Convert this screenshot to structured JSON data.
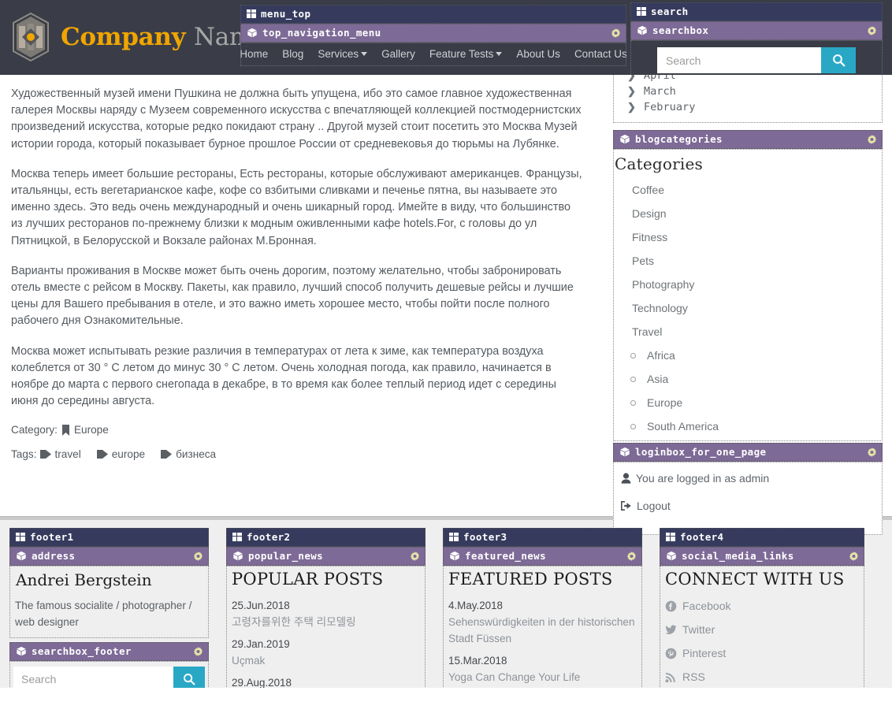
{
  "brand": {
    "name_bold": "Company",
    "name_light": "Name",
    "logo_icon": "hexagon-logo-icon"
  },
  "blocks": {
    "menu_top": "menu_top",
    "search": "search",
    "footer1": "footer1",
    "footer2": "footer2",
    "footer3": "footer3",
    "footer4": "footer4"
  },
  "widgets": {
    "top_navigation_menu": "top_navigation_menu",
    "searchbox": "searchbox",
    "blogcategories": "blogcategories",
    "loginbox_for_one_page": "loginbox_for_one_page",
    "address": "address",
    "searchbox_footer": "searchbox_footer",
    "popular_news": "popular_news",
    "featured_news": "featured_news",
    "social_media_links": "social_media_links"
  },
  "nav": {
    "items": [
      {
        "label": "Home",
        "dropdown": false
      },
      {
        "label": "Blog",
        "dropdown": false
      },
      {
        "label": "Services",
        "dropdown": true
      },
      {
        "label": "Gallery",
        "dropdown": false
      },
      {
        "label": "Feature Tests",
        "dropdown": true
      },
      {
        "label": "About Us",
        "dropdown": false
      },
      {
        "label": "Contact Us",
        "dropdown": false
      }
    ]
  },
  "search": {
    "placeholder": "Search",
    "value": "",
    "icon": "search-icon"
  },
  "article": {
    "paragraphs": [
      "Художественный музей имени Пушкина не должна быть упущена, ибо это самое главное художественная галерея Москвы наряду с Музеем современного искусства с впечатляющей коллекцией постмодернистских произведений искусства, которые редко покидают страну .. Другой музей стоит посетить это Москва Музей истории города, который показывает бурное прошлое России от средневековья до тюрьмы на Лубянке.",
      "Москва теперь имеет большие рестораны, Есть рестораны, которые обслуживают американцев. Французы, итальянцы, есть вегетарианское кафе, кофе со взбитыми сливками и печенье пятна, вы называете это именно здесь. Это ведь очень международный и очень шикарный город. Имейте в виду, что большинство из лучших ресторанов по-прежнему близки к модным оживленными кафе hotels.For, с головы до ул Пятницкой, в Белорусской и Вокзале районах М.Бронная.",
      "Варианты проживания в Москве может быть очень дорогим, поэтому желательно, чтобы забронировать отель вместе с рейсом в Москву. Пакеты, как правило, лучший способ получить дешевые рейсы и лучшие цены для Вашего пребывания в отеле, и это важно иметь хорошее место, чтобы пойти после полного рабочего дня Ознакомительные.",
      "Москва может испытывать резкие различия в температурах от лета к зиме, как температура воздуха колеблется от 30 ° С летом до минус 30 ° С летом. Очень холодная погода, как правило, начинается в ноябре до марта с первого снегопада в декабре, в то время как более теплый период идет с середины июня до середины августа."
    ],
    "category_label": "Category:",
    "category_value": "Europe",
    "category_icon": "bookmark-icon",
    "tags_label": "Tags:",
    "tags": [
      "travel",
      "europe",
      "бизнеса"
    ],
    "tag_icon": "tag-icon"
  },
  "archive": {
    "months": [
      "April",
      "March",
      "February"
    ],
    "chevron_icon": "chevron-right-icon"
  },
  "categories": {
    "title": "Categories",
    "items": [
      "Coffee",
      "Design",
      "Fitness",
      "Pets",
      "Photography",
      "Technology",
      "Travel"
    ],
    "subitems": [
      "Africa",
      "Asia",
      "Europe",
      "South America"
    ],
    "bullet_icon": "circle-bullet-icon"
  },
  "login": {
    "status": "You are logged in as admin",
    "user_icon": "user-icon",
    "logout": "Logout",
    "logout_icon": "sign-out-icon"
  },
  "footer": {
    "address": {
      "name": "Andrei Bergstein",
      "description": "The famous socialite / photographer / web designer"
    },
    "footer_search": {
      "placeholder": "Search",
      "value": "",
      "icon": "search-icon"
    },
    "popular": {
      "heading": "POPULAR POSTS",
      "posts": [
        {
          "date": "25.Jun.2018",
          "title": "고령자를위한 주택 리모델링"
        },
        {
          "date": "29.Jan.2019",
          "title": "Uçmak"
        },
        {
          "date": "29.Aug.2018",
          "title": ""
        }
      ]
    },
    "featured": {
      "heading": "FEATURED POSTS",
      "posts": [
        {
          "date": "4.May.2018",
          "title": "Sehenswürdigkeiten in der historischen Stadt Füssen"
        },
        {
          "date": "15.Mar.2018",
          "title": "Yoga Can Change Your Life"
        }
      ]
    },
    "social": {
      "heading": "CONNECT WITH US",
      "links": [
        {
          "label": "Facebook",
          "icon": "facebook-icon"
        },
        {
          "label": "Twitter",
          "icon": "twitter-icon"
        },
        {
          "label": "Pinterest",
          "icon": "pinterest-icon"
        },
        {
          "label": "RSS",
          "icon": "rss-icon"
        }
      ]
    }
  },
  "colors": {
    "block_bar": "#363b5e",
    "widget_bar": "#7d6a96",
    "header_bg": "#3a3d47",
    "brand_accent": "#f0a500",
    "search_button": "#29a8c6",
    "gear": "#e8e4a8"
  }
}
